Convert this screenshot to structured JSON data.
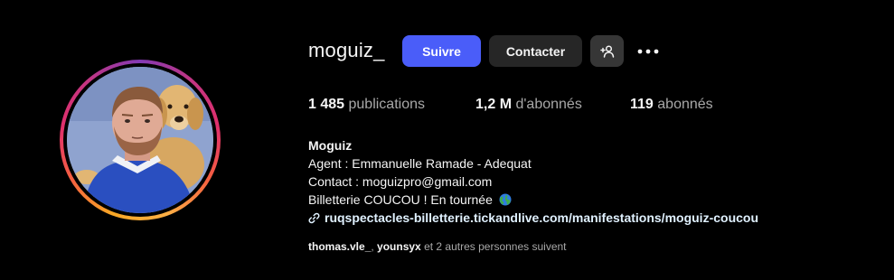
{
  "profile": {
    "username": "moguiz_",
    "avatar_icon": "profile-photo",
    "buttons": {
      "follow": "Suivre",
      "contact": "Contacter",
      "add_user_icon": "person-add-icon",
      "more_icon": "more-horizontal-icon"
    },
    "stats": {
      "posts_count": "1 485",
      "posts_label": "publications",
      "followers_count": "1,2 M",
      "followers_label": "d'abonnés",
      "following_count": "119",
      "following_label": "abonnés"
    },
    "bio": {
      "name": "Moguiz",
      "line1": "Agent : Emmanuelle Ramade - Adequat",
      "line2": "Contact : moguizpro@gmail.com",
      "line3": "Billetterie COUCOU ! En tournée",
      "line3_icon": "globe-icon",
      "link": "ruqspectacles-billetterie.tickandlive.com/manifestations/moguiz-coucou",
      "link_icon": "link-icon"
    },
    "followed_by": {
      "user1": "thomas.vle_",
      "separator": ", ",
      "user2": "younsyx",
      "suffix": " et 2 autres personnes suivent"
    }
  },
  "colors": {
    "background": "#000000",
    "follow_button": "#4a5df9",
    "secondary_button": "#262626",
    "text_primary": "#f5f5f5",
    "text_secondary": "#a8a8a8",
    "link": "#e0f1ff"
  }
}
